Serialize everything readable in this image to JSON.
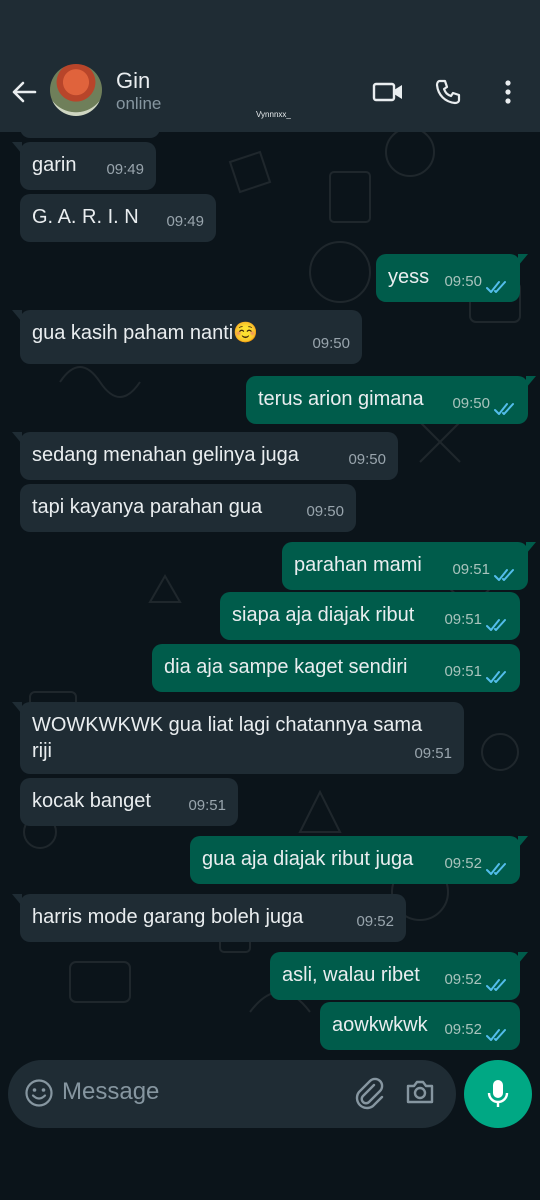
{
  "contact": {
    "name": "Gin",
    "status": "online"
  },
  "watermark": "Vynnnxx_",
  "icons": {
    "back": "arrow-left-icon",
    "video": "video-camera-icon",
    "call": "phone-icon",
    "menu": "more-vert-icon",
    "emoji": "emoji-icon",
    "attach": "paperclip-icon",
    "camera": "camera-icon",
    "mic": "microphone-icon",
    "read": "double-check-icon"
  },
  "colors": {
    "header": "#1f2c34",
    "incoming": "#1f2c34",
    "outgoing": "#005c4b",
    "accent": "#00a884",
    "read_ticks": "#53bdeb"
  },
  "messages": [
    {
      "dir": "in",
      "text": "garin",
      "time": "09:49"
    },
    {
      "dir": "in",
      "text": "G. A. R. I. N",
      "time": "09:49"
    },
    {
      "dir": "out",
      "text": "yess",
      "time": "09:50"
    },
    {
      "dir": "in",
      "text": "gua kasih paham nanti☺️",
      "time": "09:50"
    },
    {
      "dir": "out",
      "text": "terus arion gimana",
      "time": "09:50"
    },
    {
      "dir": "in",
      "text": "sedang menahan gelinya juga",
      "time": "09:50"
    },
    {
      "dir": "in",
      "text": "tapi kayanya parahan gua",
      "time": "09:50"
    },
    {
      "dir": "out",
      "text": "parahan mami",
      "time": "09:51"
    },
    {
      "dir": "out",
      "text": "siapa aja diajak ribut",
      "time": "09:51"
    },
    {
      "dir": "out",
      "text": "dia aja sampe kaget sendiri",
      "time": "09:51"
    },
    {
      "dir": "in",
      "text": "WOWKWKWK gua liat lagi chatannya sama",
      "text2": "riji",
      "time": "09:51"
    },
    {
      "dir": "in",
      "text": "kocak banget",
      "time": "09:51"
    },
    {
      "dir": "out",
      "text": "gua aja diajak ribut juga",
      "time": "09:52"
    },
    {
      "dir": "in",
      "text": "harris mode garang boleh juga",
      "time": "09:52"
    },
    {
      "dir": "out",
      "text": "asli, walau ribet",
      "time": "09:52"
    },
    {
      "dir": "out",
      "text": "aowkwkwk",
      "time": "09:52"
    }
  ],
  "composer": {
    "placeholder": "Message"
  }
}
